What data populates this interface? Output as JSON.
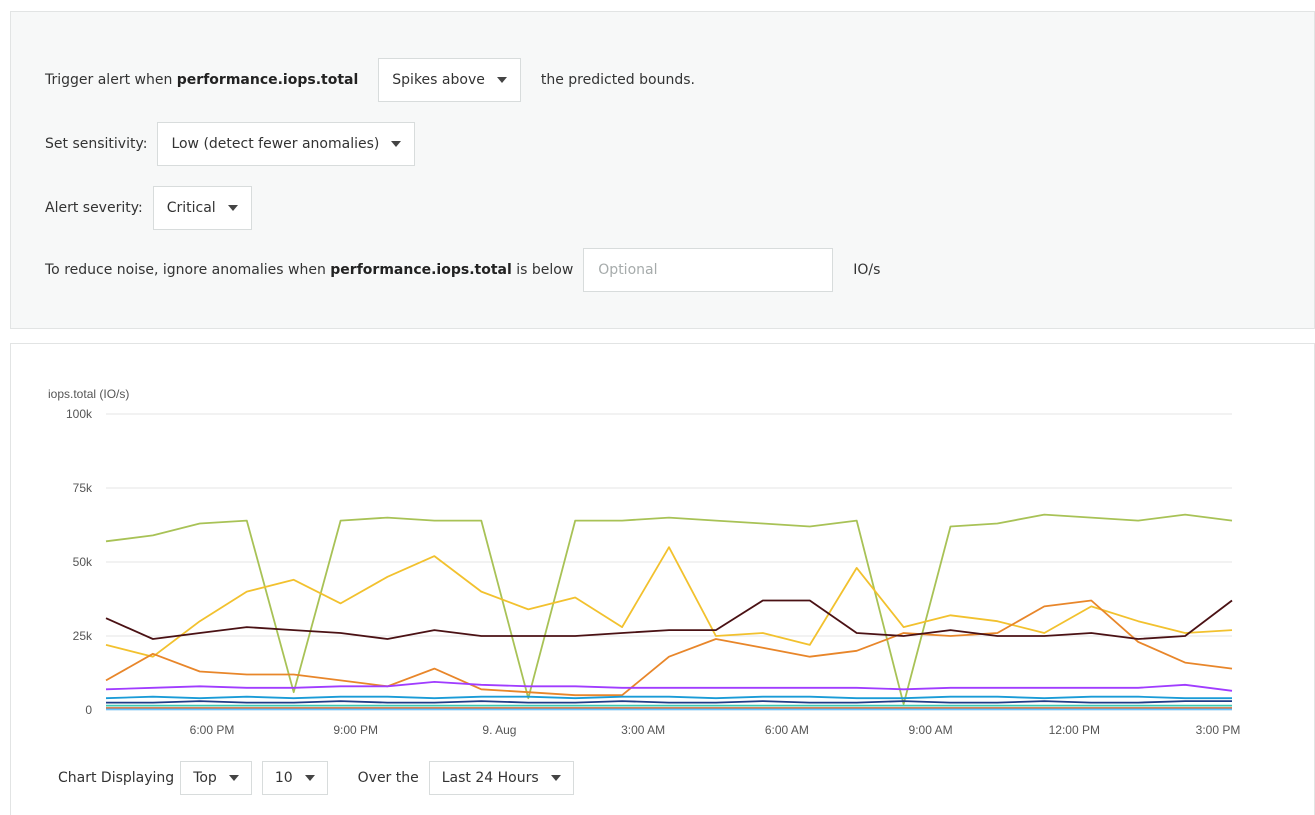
{
  "alert": {
    "trigger_prefix": "Trigger alert when",
    "metric": "performance.iops.total",
    "trigger_mode": "Spikes above",
    "trigger_suffix": "the predicted bounds.",
    "sensitivity_label": "Set sensitivity:",
    "sensitivity_value": "Low (detect fewer anomalies)",
    "severity_label": "Alert severity:",
    "severity_value": "Critical",
    "noise_prefix": "To reduce noise, ignore anomalies when",
    "noise_metric": "performance.iops.total",
    "noise_mid": "is below",
    "threshold_placeholder": "Optional",
    "threshold_value": "",
    "unit": "IO/s"
  },
  "chart_data": {
    "type": "line",
    "ylabel": "iops.total (IO/s)",
    "ylim": [
      0,
      100000
    ],
    "yticks": [
      "0",
      "25k",
      "50k",
      "75k",
      "100k"
    ],
    "xticks": [
      "6:00 PM",
      "9:00 PM",
      "9. Aug",
      "3:00 AM",
      "6:00 AM",
      "9:00 AM",
      "12:00 PM",
      "3:00 PM"
    ],
    "grid": true,
    "x": [
      "4:00 PM",
      "5:00 PM",
      "6:00 PM",
      "7:00 PM",
      "8:00 PM",
      "9:00 PM",
      "10:00 PM",
      "11:00 PM",
      "9. Aug",
      "1:00 AM",
      "2:00 AM",
      "3:00 AM",
      "4:00 AM",
      "5:00 AM",
      "6:00 AM",
      "7:00 AM",
      "8:00 AM",
      "9:00 AM",
      "10:00 AM",
      "11:00 AM",
      "12:00 PM",
      "1:00 PM",
      "2:00 PM",
      "3:00 PM",
      "3:45 PM"
    ],
    "series": [
      {
        "color": "#a8c256",
        "values": [
          57000,
          59000,
          63000,
          64000,
          6000,
          64000,
          65000,
          64000,
          64000,
          4000,
          64000,
          64000,
          65000,
          64000,
          63000,
          62000,
          64000,
          2000,
          62000,
          63000,
          66000,
          65000,
          64000,
          66000,
          64000
        ]
      },
      {
        "color": "#f2c12e",
        "values": [
          22000,
          18000,
          30000,
          40000,
          44000,
          36000,
          45000,
          52000,
          40000,
          34000,
          38000,
          28000,
          55000,
          25000,
          26000,
          22000,
          48000,
          28000,
          32000,
          30000,
          26000,
          35000,
          30000,
          26000,
          27000
        ]
      },
      {
        "color": "#e8862a",
        "values": [
          10000,
          19000,
          13000,
          12000,
          12000,
          10000,
          8000,
          14000,
          7000,
          6000,
          5000,
          5000,
          18000,
          24000,
          21000,
          18000,
          20000,
          26000,
          25000,
          26000,
          35000,
          37000,
          23000,
          16000,
          14000
        ]
      },
      {
        "color": "#4a1114",
        "values": [
          31000,
          24000,
          26000,
          28000,
          27000,
          26000,
          24000,
          27000,
          25000,
          25000,
          25000,
          26000,
          27000,
          27000,
          37000,
          37000,
          26000,
          25000,
          27000,
          25000,
          25000,
          26000,
          24000,
          25000,
          37000
        ]
      },
      {
        "color": "#a03cff",
        "values": [
          7000,
          7500,
          8000,
          7500,
          7500,
          8000,
          8000,
          9500,
          8500,
          8000,
          8000,
          7500,
          7500,
          7500,
          7500,
          7500,
          7500,
          7000,
          7500,
          7500,
          7500,
          7500,
          7500,
          8500,
          6500
        ]
      },
      {
        "color": "#1a9bd7",
        "values": [
          4000,
          4500,
          4000,
          4500,
          4000,
          4500,
          4500,
          4000,
          4500,
          4500,
          4000,
          4500,
          4500,
          4000,
          4500,
          4500,
          4000,
          4000,
          4500,
          4500,
          4000,
          4500,
          4500,
          4000,
          4000
        ]
      },
      {
        "color": "#1f3c88",
        "values": [
          2500,
          2500,
          3000,
          2500,
          2500,
          3000,
          2500,
          2500,
          3000,
          2500,
          2500,
          3000,
          2500,
          2500,
          3000,
          2500,
          2500,
          3000,
          2500,
          2500,
          3000,
          2500,
          2500,
          3000,
          3000
        ]
      },
      {
        "color": "#3cc8b4",
        "values": [
          1500,
          1500,
          1500,
          1500,
          1500,
          1500,
          1500,
          1500,
          1500,
          1500,
          1500,
          1500,
          1500,
          1500,
          1500,
          1500,
          1500,
          1500,
          1500,
          1500,
          1500,
          1500,
          1500,
          1500,
          1500
        ]
      },
      {
        "color": "#d25a1e",
        "values": [
          600,
          600,
          600,
          600,
          600,
          600,
          600,
          600,
          600,
          600,
          600,
          600,
          600,
          600,
          600,
          600,
          600,
          600,
          600,
          600,
          600,
          600,
          600,
          600,
          600
        ]
      },
      {
        "color": "#66c2ff",
        "values": [
          200,
          200,
          200,
          200,
          200,
          200,
          200,
          200,
          200,
          200,
          200,
          200,
          200,
          200,
          200,
          200,
          200,
          200,
          200,
          200,
          200,
          200,
          200,
          200,
          200
        ]
      }
    ]
  },
  "controls": {
    "displaying_label": "Chart Displaying",
    "top_value": "Top",
    "count_value": "10",
    "over_label": "Over the",
    "range_value": "Last 24 Hours"
  }
}
